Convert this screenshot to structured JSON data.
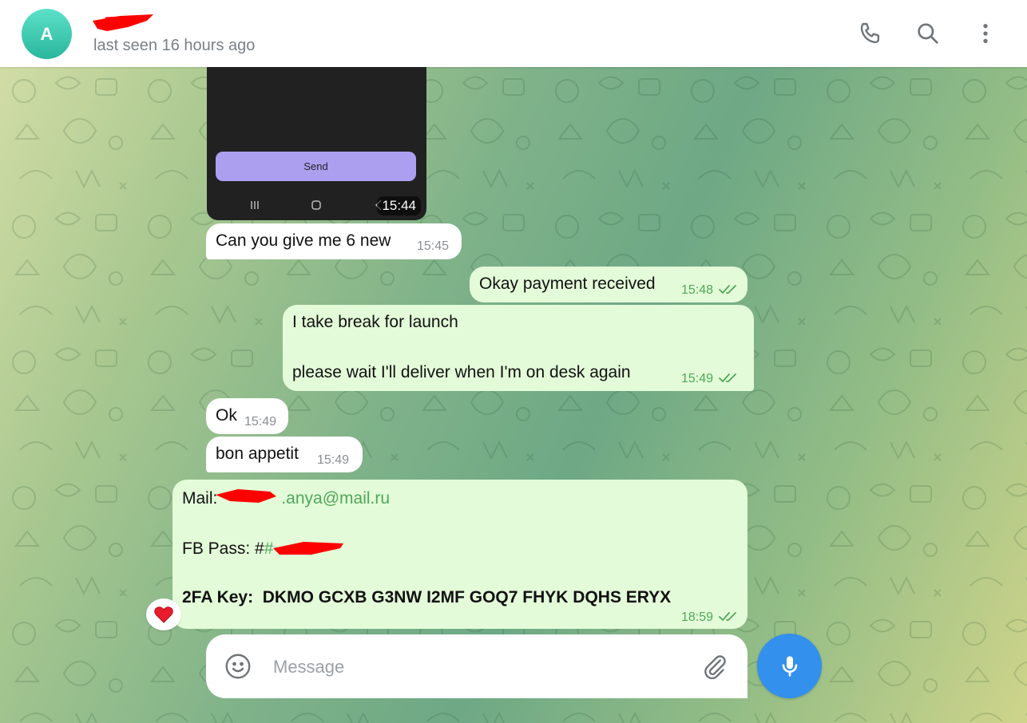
{
  "header": {
    "avatar_letter": "A",
    "status": "last seen 16 hours ago"
  },
  "media": {
    "send_label": "Send",
    "time": "15:44"
  },
  "messages": [
    {
      "direction": "in",
      "text": "Can you give me 6 new",
      "time": "15:45"
    },
    {
      "direction": "out",
      "text": "Okay payment received",
      "time": "15:48",
      "read": true
    },
    {
      "direction": "out",
      "lines": [
        "I take break for launch",
        "please wait I'll deliver when I'm on desk again"
      ],
      "time": "15:49",
      "read": true
    },
    {
      "direction": "in",
      "text": "Ok",
      "time": "15:49"
    },
    {
      "direction": "in",
      "text": "bon appetit",
      "time": "15:49"
    },
    {
      "direction": "out",
      "mail_label": "Mail:",
      "mail_visible": ".anya@mail.ru",
      "fb_label": "FB Pass: #",
      "fb_visible": "#",
      "twofa": "2FA Key:  DKMO GCXB G3NW I2MF GOQ7 FHYK DQHS ERYX",
      "time": "18:59",
      "read": true,
      "reaction": "heart"
    }
  ],
  "composer": {
    "placeholder": "Message"
  },
  "colors": {
    "outgoing_bubble": "#e3fbd8",
    "incoming_bubble": "#ffffff",
    "accent": "#3390ec",
    "link_green": "#4fa85a",
    "redaction": "#ff0000"
  },
  "icons": [
    "phone-icon",
    "search-icon",
    "more-vert-icon",
    "emoji-icon",
    "attach-icon",
    "mic-icon",
    "heart-icon",
    "double-check-icon"
  ]
}
